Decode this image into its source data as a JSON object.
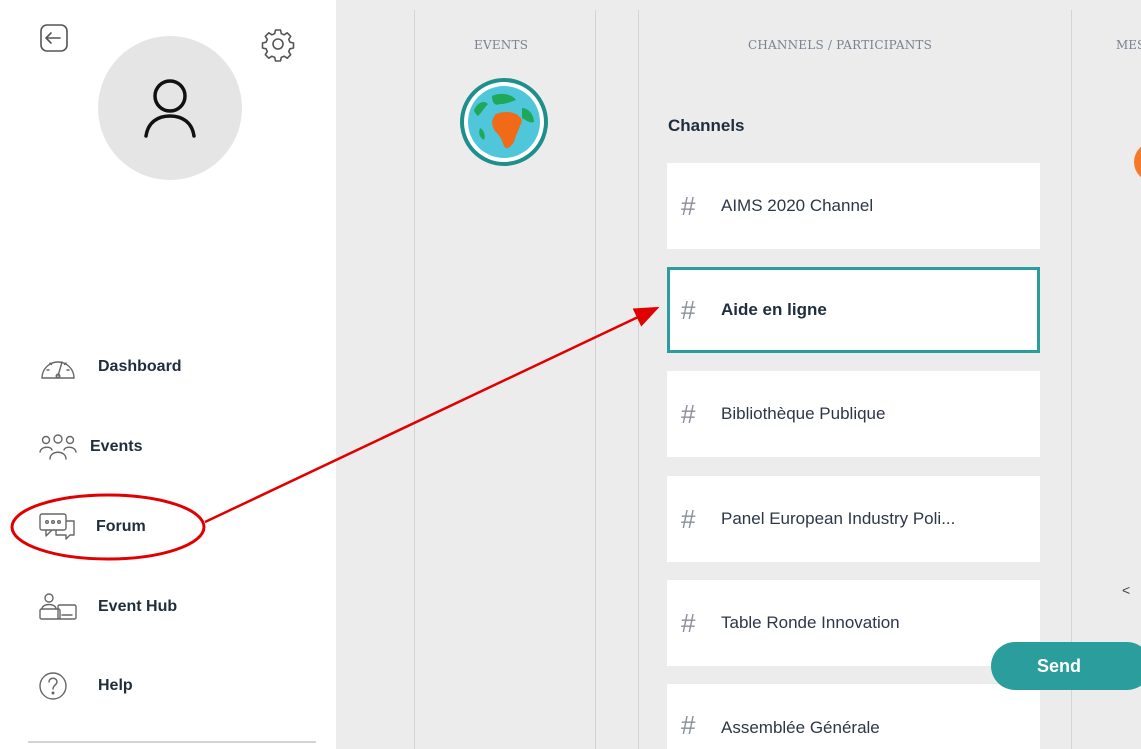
{
  "sidebar": {
    "nav": [
      {
        "label": "Dashboard",
        "icon": "gauge-icon"
      },
      {
        "label": "Events",
        "icon": "people-icon"
      },
      {
        "label": "Forum",
        "icon": "chat-icon"
      },
      {
        "label": "Event Hub",
        "icon": "hub-icon"
      },
      {
        "label": "Help",
        "icon": "help-icon"
      }
    ]
  },
  "columns": {
    "events_header": "EVENTS",
    "channels_header": "CHANNELS / PARTICIPANTS",
    "messages_header": "MES"
  },
  "channels": {
    "title": "Channels",
    "hash": "#",
    "items": [
      {
        "label": "AIMS 2020 Channel"
      },
      {
        "label": "Aide en ligne",
        "active": true
      },
      {
        "label": "Bibliothèque Publique"
      },
      {
        "label": "Panel European Industry Poli..."
      },
      {
        "label": "Table Ronde Innovation"
      },
      {
        "label": "Assemblée Générale"
      }
    ]
  },
  "messages": {
    "scroll_left": "<",
    "send_label": "Send"
  },
  "colors": {
    "accent": "#2a9d9c",
    "annotation": "#e00000",
    "background": "#ececec"
  }
}
